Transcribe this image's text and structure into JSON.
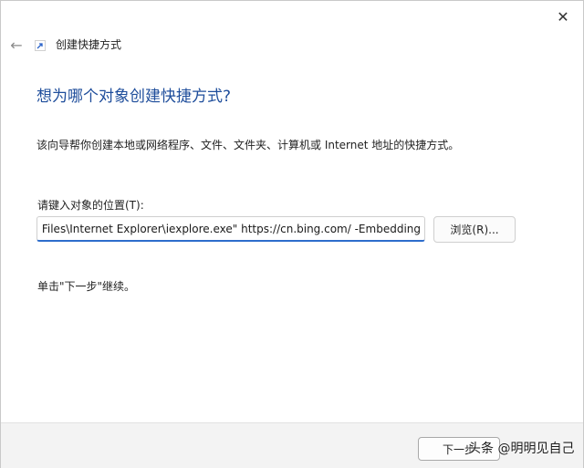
{
  "window": {
    "close_glyph": "✕",
    "back_glyph": "←"
  },
  "wizard": {
    "title": "创建快捷方式",
    "icon": "shortcut-icon",
    "heading": "想为哪个对象创建快捷方式?",
    "description": "该向导帮你创建本地或网络程序、文件、文件夹、计算机或 Internet 地址的快捷方式。",
    "location_label": "请键入对象的位置(T):",
    "location_value": "C:\\Program Files\\Internet Explorer\\iexplore.exe\" https://cn.bing.com/ -Embedding",
    "browse_label": "浏览(R)...",
    "hint": "单击\"下一步\"继续。"
  },
  "footer": {
    "next_label": "下一步",
    "watermark": "头条 @明明见自己"
  },
  "colors": {
    "heading": "#1e4d9b",
    "input_focus": "#2d6dcc",
    "footer_bg": "#f3f3f3"
  }
}
